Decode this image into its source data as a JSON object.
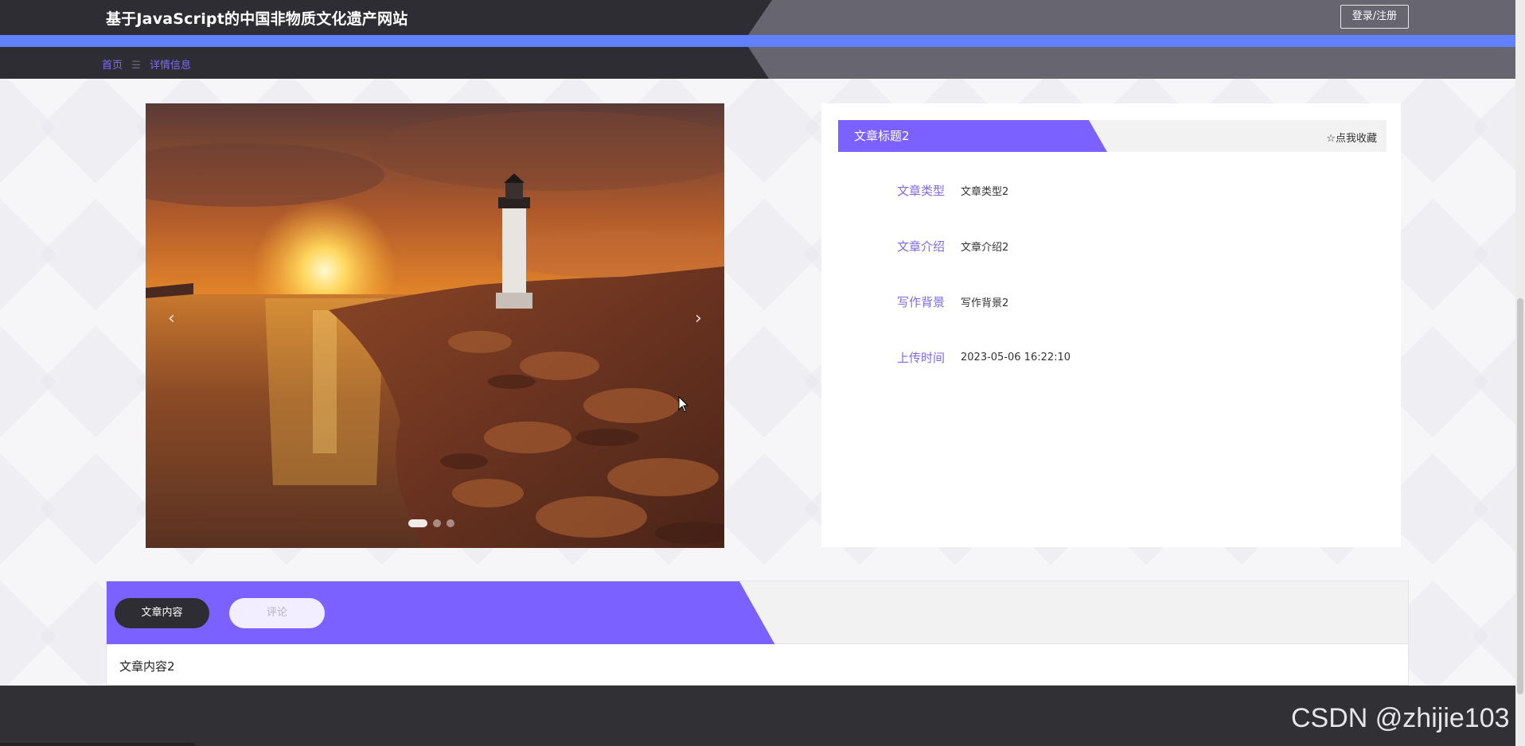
{
  "header": {
    "site_title": "基于JavaScript的中国非物质文化遗产网站",
    "login_label": "登录/注册"
  },
  "breadcrumb": {
    "home": "首页",
    "separator": "☰",
    "current": "详情信息"
  },
  "carousel": {
    "prev_icon": "‹",
    "next_icon": "›",
    "slide_count": 3,
    "active_index": 0,
    "image": "lighthouse-sunset-photo"
  },
  "article": {
    "title": "文章标题2",
    "favorite_label": "☆点我收藏",
    "fields": [
      {
        "label": "文章类型",
        "value": "文章类型2"
      },
      {
        "label": "文章介绍",
        "value": "文章介绍2"
      },
      {
        "label": "写作背景",
        "value": "写作背景2"
      },
      {
        "label": "上传时间",
        "value": "2023-05-06 16:22:10"
      }
    ]
  },
  "tabs": {
    "content_label": "文章内容",
    "comment_label": "评论",
    "content_text": "文章内容2"
  },
  "watermark": "CSDN @zhijie103",
  "colors": {
    "accent_purple": "#7b61ff",
    "accent_blue": "#6281ff",
    "dark_bar": "#2e2d33"
  }
}
